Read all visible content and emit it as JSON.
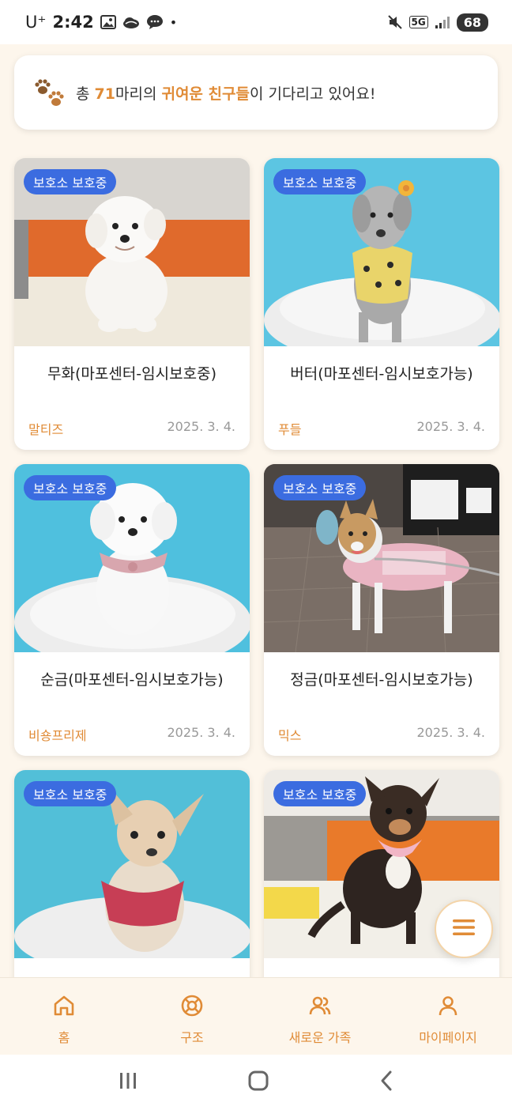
{
  "status_bar": {
    "carrier": "U⁺",
    "time": "2:42",
    "dot": "•",
    "network": "5G",
    "battery": "68",
    "icons": [
      "gallery-icon",
      "cloud-icon",
      "chat-icon",
      "mute-icon",
      "signal-icon"
    ]
  },
  "banner": {
    "prefix": "총 ",
    "count": "71",
    "middle": "마리의 ",
    "highlight": "귀여운 친구들",
    "suffix": "이 기다리고 있어요!",
    "icon": "paw-icon"
  },
  "cards": [
    {
      "badge": "보호소 보호중",
      "title": "무화(마포센터-임시보호중)",
      "breed": "말티즈",
      "date": "2025. 3. 4."
    },
    {
      "badge": "보호소 보호중",
      "title": "버터(마포센터-임시보호가능)",
      "breed": "푸들",
      "date": "2025. 3. 4."
    },
    {
      "badge": "보호소 보호중",
      "title": "순금(마포센터-임시보호가능)",
      "breed": "비숑프리제",
      "date": "2025. 3. 4."
    },
    {
      "badge": "보호소 보호중",
      "title": "정금(마포센터-임시보호가능)",
      "breed": "믹스",
      "date": "2025. 3. 4."
    },
    {
      "badge": "보호소 보호중"
    },
    {
      "badge": "보호소 보호중"
    }
  ],
  "fab": {
    "icon": "menu-icon"
  },
  "bottom_nav": [
    {
      "label": "홈",
      "icon": "home-icon"
    },
    {
      "label": "구조",
      "icon": "lifebuoy-icon"
    },
    {
      "label": "새로운 가족",
      "icon": "users-icon"
    },
    {
      "label": "마이페이지",
      "icon": "user-icon"
    }
  ],
  "colors": {
    "accent": "#E08B36",
    "badge": "#3B6CE0",
    "background": "#FDF6EC"
  }
}
